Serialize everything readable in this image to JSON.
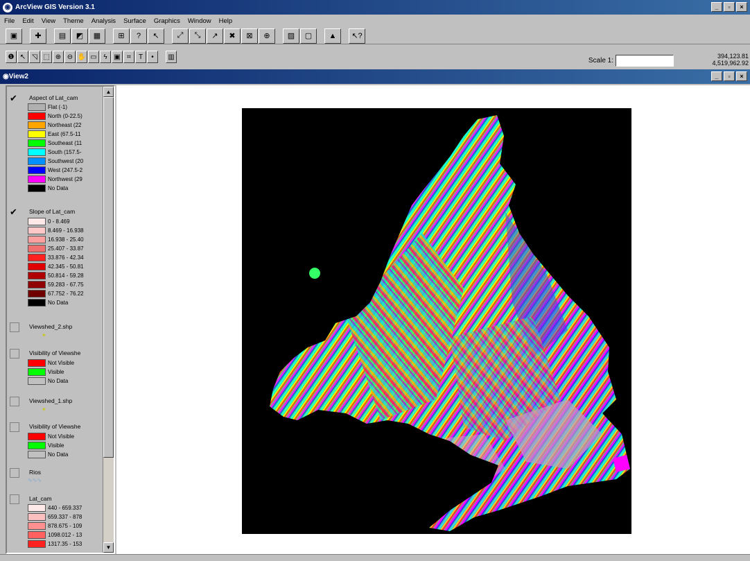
{
  "app": {
    "title": "ArcView GIS Version 3.1"
  },
  "menu": [
    "File",
    "Edit",
    "View",
    "Theme",
    "Analysis",
    "Surface",
    "Graphics",
    "Window",
    "Help"
  ],
  "scale": {
    "label": "Scale 1:",
    "value": ""
  },
  "coords": {
    "x": "394,123.81",
    "y": "4,519,962.92"
  },
  "view": {
    "title": "View2"
  },
  "toc": {
    "aspect": {
      "name": "Aspect of Lat_cam",
      "classes": [
        {
          "label": "Flat (-1)",
          "color": "#b0b0b0"
        },
        {
          "label": "North (0-22.5)",
          "color": "#ff0000"
        },
        {
          "label": "Northeast (22",
          "color": "#ffa500"
        },
        {
          "label": "East (67.5-11",
          "color": "#ffff00"
        },
        {
          "label": "Southeast (11",
          "color": "#00ff00"
        },
        {
          "label": "South (157.5-",
          "color": "#00ffff"
        },
        {
          "label": "Southwest (20",
          "color": "#0090ff"
        },
        {
          "label": "West (247.5-2",
          "color": "#0000ff"
        },
        {
          "label": "Northwest (29",
          "color": "#ff00ff"
        },
        {
          "label": "No Data",
          "color": "#000000"
        }
      ]
    },
    "slope": {
      "name": "Slope of Lat_cam",
      "classes": [
        {
          "label": "0 - 8.469",
          "color": "#ffe8e8"
        },
        {
          "label": "8.469 - 16.938",
          "color": "#ffc8c8"
        },
        {
          "label": "16.938 - 25.40",
          "color": "#ffa0a0"
        },
        {
          "label": "25.407 - 33.87",
          "color": "#f07070"
        },
        {
          "label": "33.876 - 42.34",
          "color": "#ff2020"
        },
        {
          "label": "42.345 - 50.81",
          "color": "#e00000"
        },
        {
          "label": "50.814 - 59.28",
          "color": "#b00000"
        },
        {
          "label": "59.283 - 67.75",
          "color": "#900000"
        },
        {
          "label": "67.752 - 76.22",
          "color": "#700000"
        },
        {
          "label": "No Data",
          "color": "#000000"
        }
      ]
    },
    "viewshed2": {
      "name": "Viewshed_2.shp"
    },
    "vis1": {
      "name": "Visibility of Viewshe",
      "classes": [
        {
          "label": "Not Visible",
          "color": "#ff0000"
        },
        {
          "label": "Visible",
          "color": "#00ff00"
        },
        {
          "label": "No Data",
          "color": "#c0c0c0"
        }
      ]
    },
    "viewshed1": {
      "name": "Viewshed_1.shp"
    },
    "vis2": {
      "name": "Visibility of Viewshe",
      "classes": [
        {
          "label": "Not Visible",
          "color": "#ff0000"
        },
        {
          "label": "Visible",
          "color": "#00ff00"
        },
        {
          "label": "No Data",
          "color": "#c0c0c0"
        }
      ]
    },
    "rios": {
      "name": "Rios"
    },
    "latcam": {
      "name": "Lat_cam",
      "classes": [
        {
          "label": "440 - 659.337",
          "color": "#ffe8e8"
        },
        {
          "label": "659.337 - 878",
          "color": "#ffc0c0"
        },
        {
          "label": "878.675 - 109",
          "color": "#ff9090"
        },
        {
          "label": "1098.012 - 13",
          "color": "#ff6060"
        },
        {
          "label": "1317.35 - 153",
          "color": "#ff2020"
        }
      ]
    }
  }
}
